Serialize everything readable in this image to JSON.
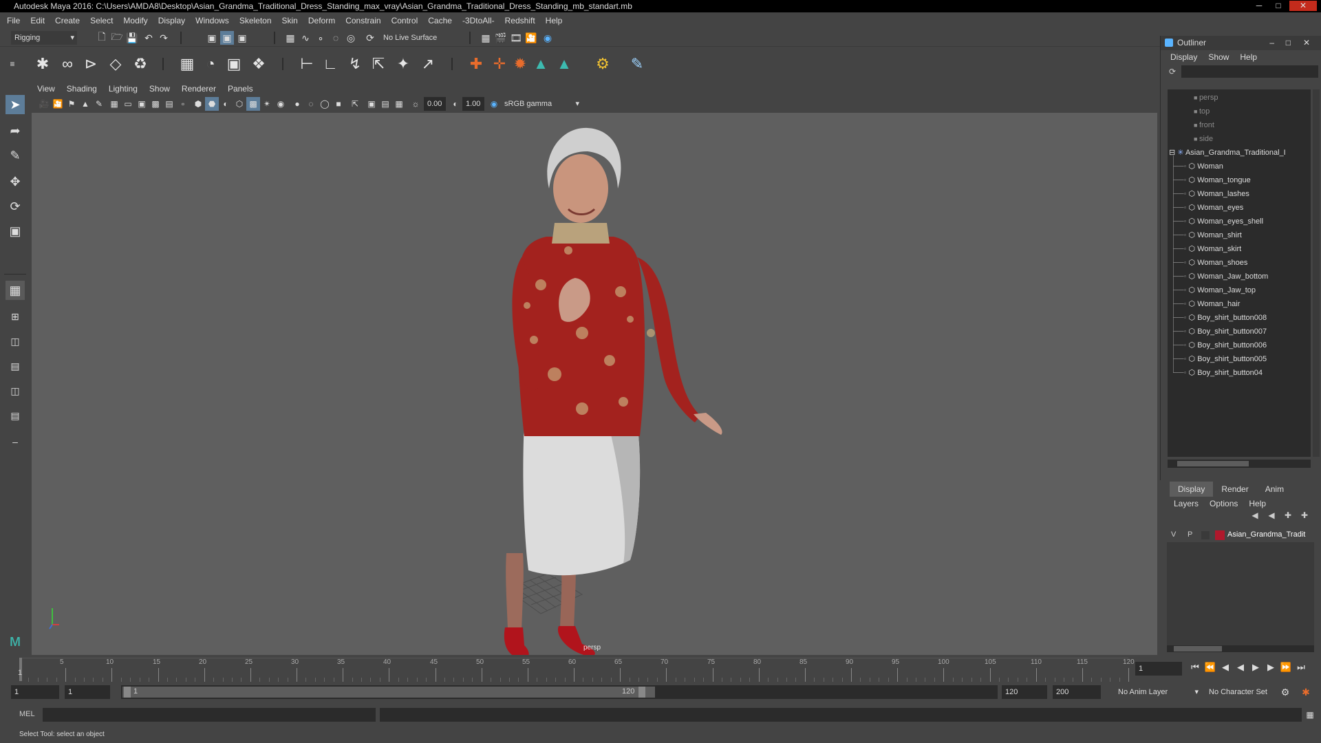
{
  "window": {
    "title": "Autodesk Maya 2016: C:\\Users\\AMDA8\\Desktop\\Asian_Grandma_Traditional_Dress_Standing_max_vray\\Asian_Grandma_Traditional_Dress_Standing_mb_standart.mb"
  },
  "menubar": {
    "items": [
      "File",
      "Edit",
      "Create",
      "Select",
      "Modify",
      "Display",
      "Windows",
      "Skeleton",
      "Skin",
      "Deform",
      "Constrain",
      "Control",
      "Cache",
      "-3DtoAll-",
      "Redshift",
      "Help"
    ]
  },
  "statusline": {
    "mode": "Rigging",
    "live_surface": "No Live Surface"
  },
  "viewport": {
    "menu": [
      "View",
      "Shading",
      "Lighting",
      "Show",
      "Renderer",
      "Panels"
    ],
    "near_value": "0.00",
    "far_value": "1.00",
    "color_space": "sRGB gamma",
    "camera_label": "persp"
  },
  "outliner": {
    "title": "Outliner",
    "menu": [
      "Display",
      "Show",
      "Help"
    ],
    "cameras": [
      "persp",
      "top",
      "front",
      "side"
    ],
    "group": "Asian_Grandma_Traditional_I",
    "children": [
      "Woman",
      "Woman_tongue",
      "Woman_lashes",
      "Woman_eyes",
      "Woman_eyes_shell",
      "Woman_shirt",
      "Woman_skirt",
      "Woman_shoes",
      "Woman_Jaw_bottom",
      "Woman_Jaw_top",
      "Woman_hair",
      "Boy_shirt_button008",
      "Boy_shirt_button007",
      "Boy_shirt_button006",
      "Boy_shirt_button005",
      "Boy_shirt_button04"
    ]
  },
  "layers": {
    "tabs": [
      "Display",
      "Render",
      "Anim"
    ],
    "menu": [
      "Layers",
      "Options",
      "Help"
    ],
    "rows": [
      {
        "v": "V",
        "p": "P",
        "color": "#b0182c",
        "name": "Asian_Grandma_Tradit"
      }
    ]
  },
  "timeline": {
    "ticks": [
      "5",
      "10",
      "15",
      "20",
      "25",
      "30",
      "35",
      "40",
      "45",
      "50",
      "55",
      "60",
      "65",
      "70",
      "75",
      "80",
      "85",
      "90",
      "95",
      "100",
      "105",
      "110",
      "115",
      "120"
    ],
    "start_label": "1",
    "current_frame": "1"
  },
  "range": {
    "start": "1",
    "playback_start": "1",
    "slider_start": "1",
    "slider_end": "120",
    "playback_end": "120",
    "end": "200",
    "anim_layer": "No Anim Layer",
    "character_set": "No Character Set"
  },
  "command": {
    "label": "MEL"
  },
  "helpline": {
    "text": "Select Tool: select an object"
  }
}
